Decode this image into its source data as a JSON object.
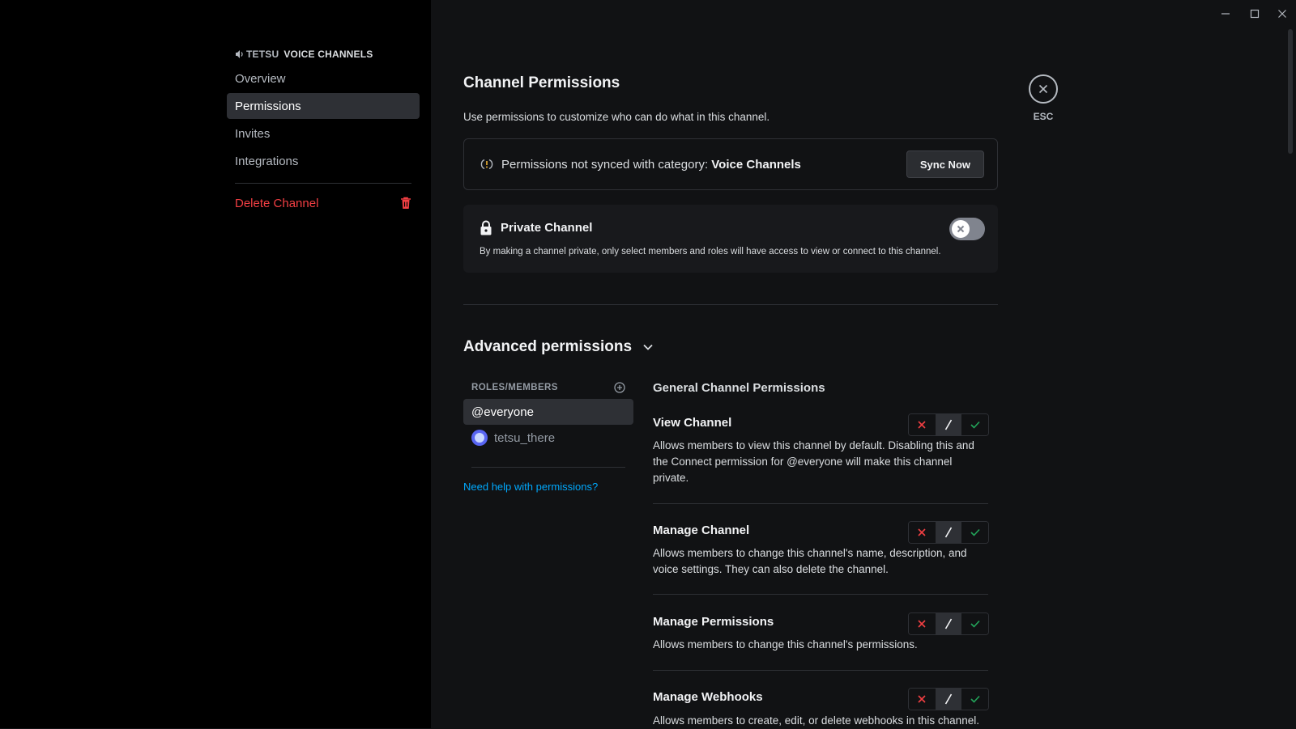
{
  "window": {
    "minimize_icon": "minimize-icon",
    "maximize_icon": "maximize-icon",
    "close_icon": "close-icon"
  },
  "sidebar": {
    "header_prefix": "TETSU",
    "header_category": "VOICE CHANNELS",
    "items": [
      {
        "label": "Overview",
        "active": false
      },
      {
        "label": "Permissions",
        "active": true
      },
      {
        "label": "Invites",
        "active": false
      },
      {
        "label": "Integrations",
        "active": false
      }
    ],
    "delete_label": "Delete Channel"
  },
  "header": {
    "title": "Channel Permissions",
    "subtitle": "Use permissions to customize who can do what in this channel.",
    "close_label": "ESC"
  },
  "sync": {
    "text": "Permissions not synced with category: ",
    "category": "Voice Channels",
    "button": "Sync Now"
  },
  "private_channel": {
    "title": "Private Channel",
    "description": "By making a channel private, only select members and roles will have access to view or connect to this channel.",
    "enabled": false
  },
  "advanced": {
    "title": "Advanced permissions",
    "roles_header": "ROLES/MEMBERS",
    "roles": [
      {
        "label": "@everyone",
        "active": true
      },
      {
        "label": "tetsu_there",
        "active": false
      }
    ],
    "help_link": "Need help with permissions?",
    "section_title": "General Channel Permissions",
    "permissions": [
      {
        "name": "View Channel",
        "description": "Allows members to view this channel by default. Disabling this and the Connect permission for @everyone will make this channel private.",
        "state": "neutral"
      },
      {
        "name": "Manage Channel",
        "description": "Allows members to change this channel's name, description, and voice settings. They can also delete the channel.",
        "state": "neutral"
      },
      {
        "name": "Manage Permissions",
        "description": "Allows members to change this channel's permissions.",
        "state": "neutral"
      },
      {
        "name": "Manage Webhooks",
        "description": "Allows members to create, edit, or delete webhooks in this channel.",
        "state": "neutral"
      }
    ]
  },
  "colors": {
    "deny": "#f23f43",
    "allow": "#23a55a",
    "link": "#00a8fc",
    "danger": "#f23f43"
  }
}
